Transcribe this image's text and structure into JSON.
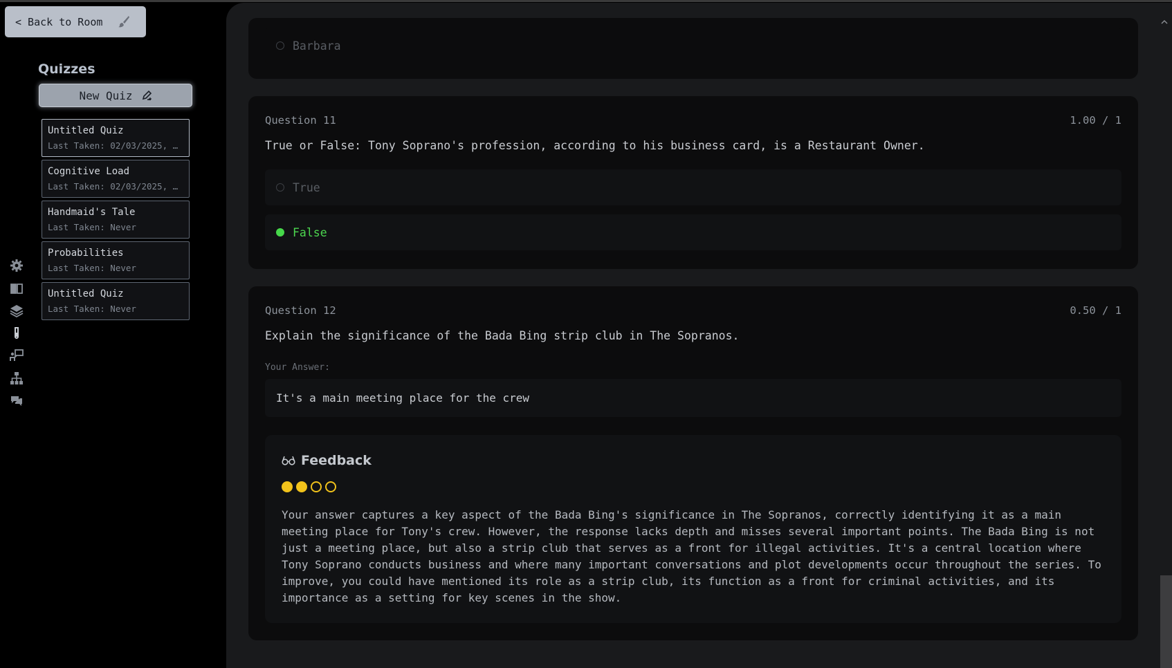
{
  "sidebar": {
    "back_label": "< Back to Room",
    "quizzes_title": "Quizzes",
    "new_quiz_label": "New Quiz",
    "rail_icons": [
      "gear-icon",
      "book-icon",
      "layers-icon",
      "flask-icon",
      "presenter-icon",
      "hierarchy-icon",
      "chat-icon"
    ],
    "quizzes": [
      {
        "name": "Untitled Quiz",
        "last_taken": "Last Taken: 02/03/2025, …",
        "active": true
      },
      {
        "name": "Cognitive Load",
        "last_taken": "Last Taken: 02/03/2025, …",
        "active": false
      },
      {
        "name": "Handmaid's Tale",
        "last_taken": "Last Taken: Never",
        "active": false
      },
      {
        "name": "Probabilities",
        "last_taken": "Last Taken: Never",
        "active": false
      },
      {
        "name": "Untitled Quiz",
        "last_taken": "Last Taken: Never",
        "active": false
      }
    ]
  },
  "main": {
    "prev_option": "Barbara",
    "q11": {
      "label": "Question 11",
      "score": "1.00 / 1",
      "text": "True or False: Tony Soprano's profession, according to his business card, is a Restaurant Owner.",
      "options": [
        {
          "label": "True",
          "selected": false
        },
        {
          "label": "False",
          "selected": true
        }
      ]
    },
    "q12": {
      "label": "Question 12",
      "score": "0.50 / 1",
      "text": "Explain the significance of the Bada Bing strip club in The Sopranos.",
      "answer_label": "Your Answer:",
      "answer": "It's a main meeting place for the crew",
      "feedback_title": "Feedback",
      "rating": 2,
      "rating_max": 4,
      "feedback_lines": [
        "Your answer captures a key aspect of the Bada Bing's significance in The Sopranos, correctly identifying it as a main",
        "meeting place for Tony's crew. However, the response lacks depth and misses several important points. The Bada Bing is not",
        "just a meeting place, but also a strip club that serves as a front for illegal activities. It's a central location where",
        "Tony Soprano conducts business and where many important conversations and plot developments occur throughout the series. To",
        "improve, you could have mentioned its role as a strip club, its function as a front for criminal activities, and its",
        "importance as a setting for key scenes in the show."
      ]
    }
  },
  "colors": {
    "accent_green": "#46d84a",
    "rating_yellow": "#f1c21b"
  }
}
